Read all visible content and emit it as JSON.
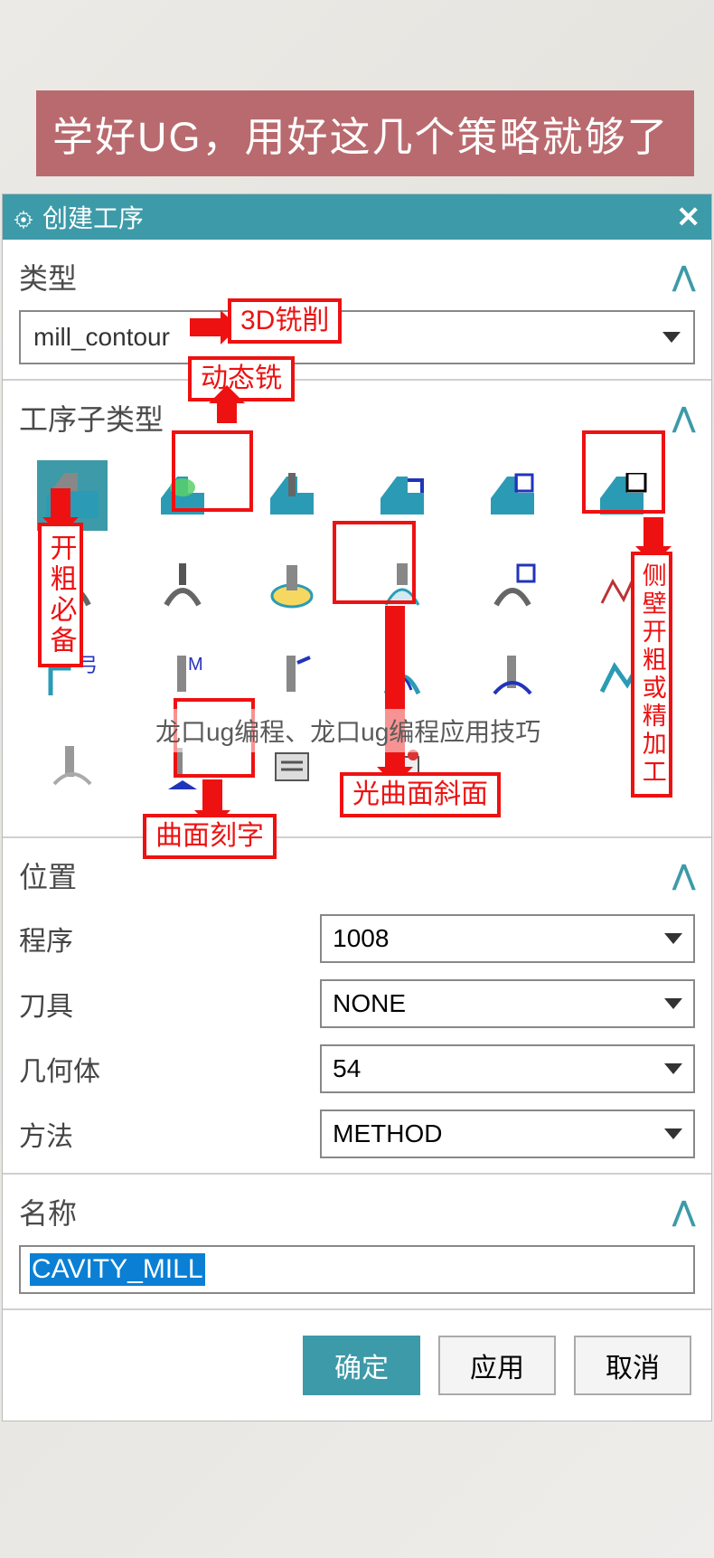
{
  "banner": "学好UG，用好这几个策略就够了",
  "dialog": {
    "title": "创建工序",
    "type_section": "类型",
    "type_value": "mill_contour",
    "subtype_section": "工序子类型",
    "location_section": "位置",
    "name_section": "名称",
    "location": {
      "program_label": "程序",
      "program_value": "1008",
      "tool_label": "刀具",
      "tool_value": "NONE",
      "geometry_label": "几何体",
      "geometry_value": "54",
      "method_label": "方法",
      "method_value": "METHOD"
    },
    "name_value": "CAVITY_MILL",
    "buttons": {
      "ok": "确定",
      "apply": "应用",
      "cancel": "取消"
    }
  },
  "annotations": {
    "a3d": "3D铣削",
    "dynamic": "动态铣",
    "rough": "开粗必备",
    "sidewall": "侧壁开粗或精加工",
    "curved": "光曲面斜面",
    "engrave": "曲面刻字"
  },
  "watermark": "龙口ug编程、龙口ug编程应用技巧",
  "colors": {
    "accent": "#3d9aa8",
    "annotation": "#e11"
  }
}
